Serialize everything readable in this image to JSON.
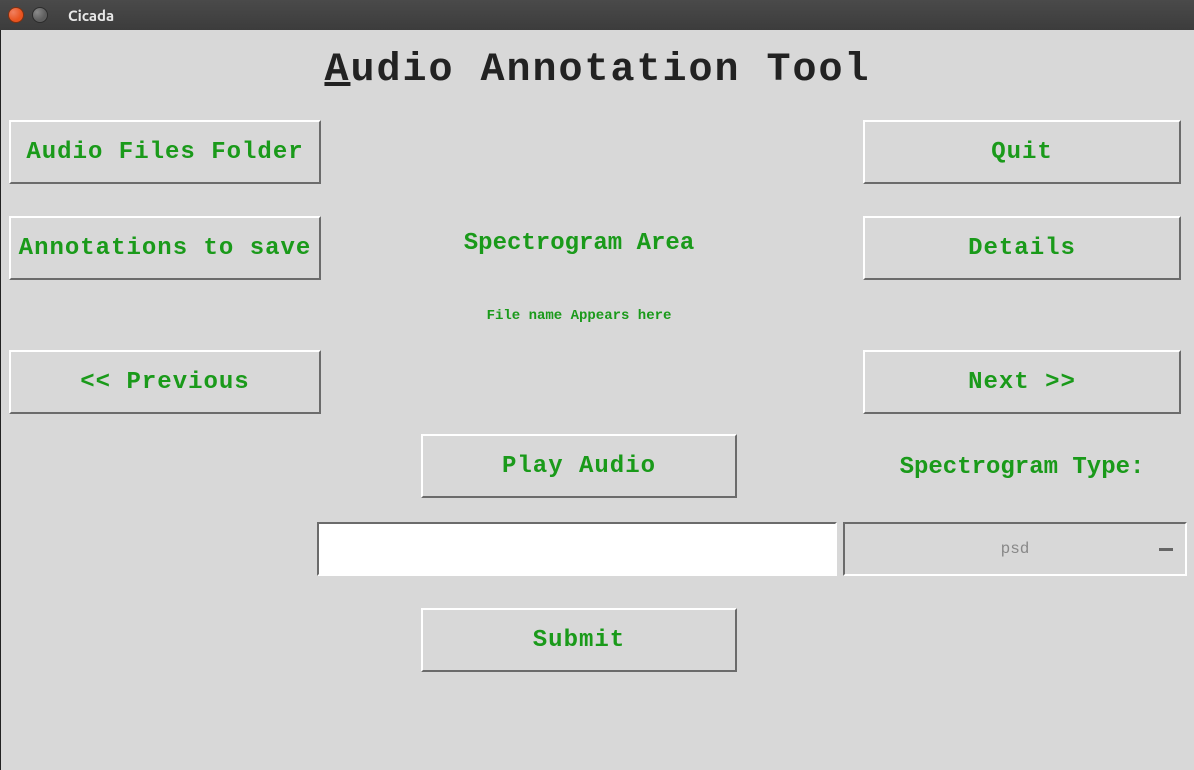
{
  "window": {
    "title": "Cicada"
  },
  "header": {
    "title_part_underlined": "A",
    "title_rest": "udio Annotation Tool"
  },
  "buttons": {
    "audio_folder": "Audio Files Folder",
    "annotations_save": "Annotations to save",
    "previous": "<< Previous",
    "quit": "Quit",
    "details": "Details",
    "next": "Next >>",
    "play": "Play Audio",
    "submit": "Submit"
  },
  "labels": {
    "spectrogram_area": "Spectrogram Area",
    "filename": "File name Appears here",
    "spectrogram_type": "Spectrogram Type:"
  },
  "input": {
    "annotation_value": ""
  },
  "select": {
    "spectrogram_type_value": "psd"
  }
}
